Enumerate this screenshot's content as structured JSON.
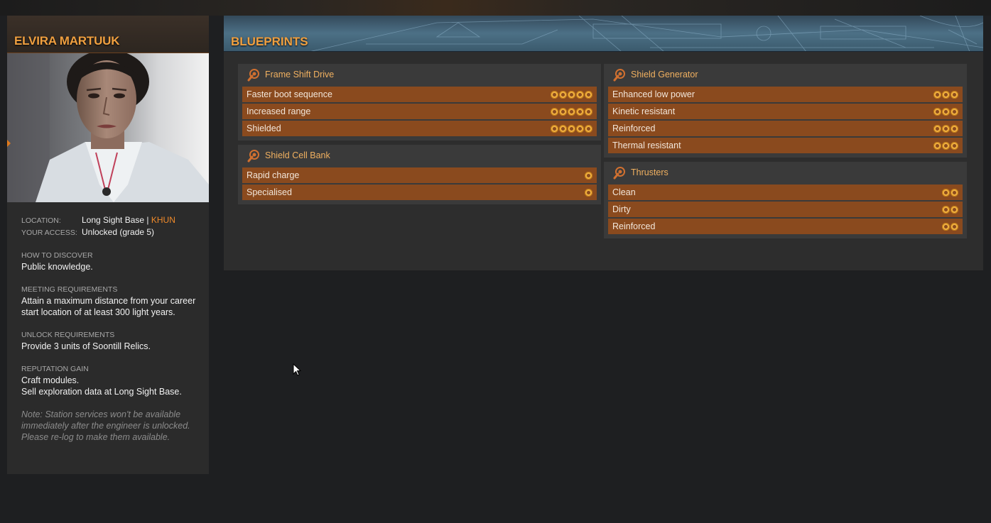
{
  "engineer": {
    "name": "ELVIRA MARTUUK",
    "location_label": "LOCATION:",
    "location_value": "Long Sight Base",
    "location_separator": "|",
    "location_system": "KHUN",
    "access_label": "YOUR ACCESS:",
    "access_value": "Unlocked (grade 5)",
    "discover_label": "HOW TO DISCOVER",
    "discover_text": "Public knowledge.",
    "meeting_label": "MEETING REQUIREMENTS",
    "meeting_text": "Attain a maximum distance from your career start location of at least 300 light years.",
    "unlock_label": "UNLOCK REQUIREMENTS",
    "unlock_text": "Provide 3 units of Soontill Relics.",
    "reputation_label": "REPUTATION GAIN",
    "reputation_line1": "Craft modules.",
    "reputation_line2": "Sell exploration data at Long Sight Base.",
    "note": "Note: Station services won't be available immediately after the engineer is unlocked. Please re-log to make them available."
  },
  "blueprints": {
    "title": "BLUEPRINTS",
    "left_groups": [
      {
        "title": "Frame Shift Drive",
        "icon": "engineering-icon",
        "items": [
          {
            "label": "Faster boot sequence",
            "grade": 5
          },
          {
            "label": "Increased range",
            "grade": 5
          },
          {
            "label": "Shielded",
            "grade": 5
          }
        ]
      },
      {
        "title": "Shield Cell Bank",
        "icon": "engineering-icon",
        "items": [
          {
            "label": "Rapid charge",
            "grade": 1
          },
          {
            "label": "Specialised",
            "grade": 1
          }
        ]
      }
    ],
    "right_groups": [
      {
        "title": "Shield Generator",
        "icon": "engineering-icon",
        "items": [
          {
            "label": "Enhanced low power",
            "grade": 3
          },
          {
            "label": "Kinetic resistant",
            "grade": 3
          },
          {
            "label": "Reinforced",
            "grade": 3
          },
          {
            "label": "Thermal resistant",
            "grade": 3
          }
        ]
      },
      {
        "title": "Thrusters",
        "icon": "engineering-icon",
        "items": [
          {
            "label": "Clean",
            "grade": 2
          },
          {
            "label": "Dirty",
            "grade": 2
          },
          {
            "label": "Reinforced",
            "grade": 2
          }
        ]
      }
    ]
  },
  "colors": {
    "accent": "#f0a040",
    "row_bg": "#8a4a1e",
    "system_highlight": "#f08a2a"
  }
}
